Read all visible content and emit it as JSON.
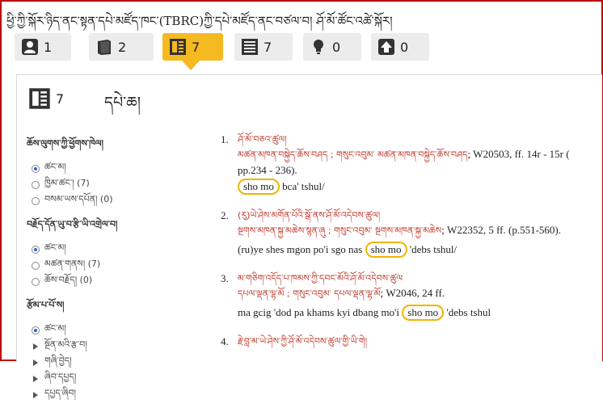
{
  "header": {
    "title": "ཕྱི་ཀྱི་སྐོར་ཉིད་ནང་སྟན་དཔེ་མཛོད་ཁང་(TBRC)ཀྱི་དཔེ་མཛོད་ནང་བཙལ་བ། ཤོ་མོ་ཚོང་འཚེ་སྐོར།"
  },
  "tabs": [
    {
      "icon": "person-icon",
      "count": "1"
    },
    {
      "icon": "book-icon",
      "count": "2"
    },
    {
      "icon": "text-list-icon",
      "count": "7",
      "active": true
    },
    {
      "icon": "text-list-icon",
      "count": "7"
    },
    {
      "icon": "lightbulb-icon",
      "count": "0"
    },
    {
      "icon": "upload-icon",
      "count": "0"
    }
  ],
  "panel": {
    "count": "7",
    "title": "དཔེ་ཆ།"
  },
  "facets": [
    {
      "heading": "ཆོས་ལུགས་ཀྱི་ཕྱོགས་ཁེལ།",
      "options": [
        {
          "label": "ཚང་མ།",
          "selected": true
        },
        {
          "label": "ཁྱིམ་ཚང་། (7)",
          "selected": false
        },
        {
          "label": "བསམ་ཡས་དཔོན། (0)",
          "selected": false
        }
      ]
    },
    {
      "heading": "བརྗོད་དོན་ཡུ་བ་རྩི་ཡི་འགྲེལ་བ།",
      "options": [
        {
          "label": "ཚང་མ།",
          "selected": true
        },
        {
          "label": "མཚན་གནས། (7)",
          "selected": false
        },
        {
          "label": "ཆོས་བརྗོད། (0)",
          "selected": false
        }
      ]
    },
    {
      "heading": "རྩོམ་པ་པོ་ས།",
      "options": [
        {
          "label": "ཚང་མ།",
          "selected": true
        }
      ],
      "expanders": [
        "སྔོན་མའི་རྩ་བ།",
        "གཞི་བྱེད།",
        "ཞིབ་དཔྱད།",
        "དཔྱད་ཞིབ།"
      ]
    }
  ],
  "results": [
    {
      "num": "1.",
      "tib_title": "ཤོ་མོ་བཅའ་ཚུལ།",
      "tib_sub": "མཚན་མཁན་བསྐྱེད་ཆོས་བཤད ;  གསུང་འབུམ་ མཚན་མཁན་བསྐྱེད་ཆོས་བཤད",
      "ref": "; W20503, ff. 14r - 15r (",
      "ref2": "pp.234 - 236).",
      "translit_pre": "",
      "highlight": "sho mo",
      "translit_post": " bca' tshul/"
    },
    {
      "num": "2.",
      "tib_title": "(རུ)ཡེ་ཤེས་མགོན་པོའི་སྒོ་ནས་ཤོ་མོ་འདེབས་ཚུལ།",
      "tib_sub": "སྔགས་མཁན་སྐྱ་མཆེས་སྙན་ཞུ ;  གསུང་འབུམ་ སྔགས་མཁན་སྐྱ་མཆེས",
      "ref": "; W22352, 5 ff. (p.551-560).",
      "ref2": "",
      "translit_pre": "(ru)ye shes mgon po'i sgo nas ",
      "highlight": "sho mo",
      "translit_post": " 'debs tshul/"
    },
    {
      "num": "3.",
      "tib_title": "མ་གཅིག་འདོད་པ་ཁམས་ཀྱི་དབང་མོའི་ཤོ་མོ་འདེབས་ཚུལ",
      "tib_sub": "དཔལ་ལྡན་ལྷ་མོ ;  གསུང་འབུམ་ དཔལ་ལྡན་ལྷ་མོ",
      "ref": "; W2046, 24 ff.",
      "ref2": "",
      "translit_pre": "ma gcig 'dod pa khams kyi dbang mo'i ",
      "highlight": "sho mo",
      "translit_post": " 'debs tshul"
    },
    {
      "num": "4.",
      "tib_title": "རྗེ་བླ་མ་ཡེ་ཤེས་ཀྱི་ཤོ་མོ་འདེབས་ཚུལ་གྱི་ཡི་གེ།",
      "tib_sub": "",
      "ref": "",
      "ref2": "",
      "translit_pre": "",
      "highlight": "",
      "translit_post": ""
    }
  ]
}
